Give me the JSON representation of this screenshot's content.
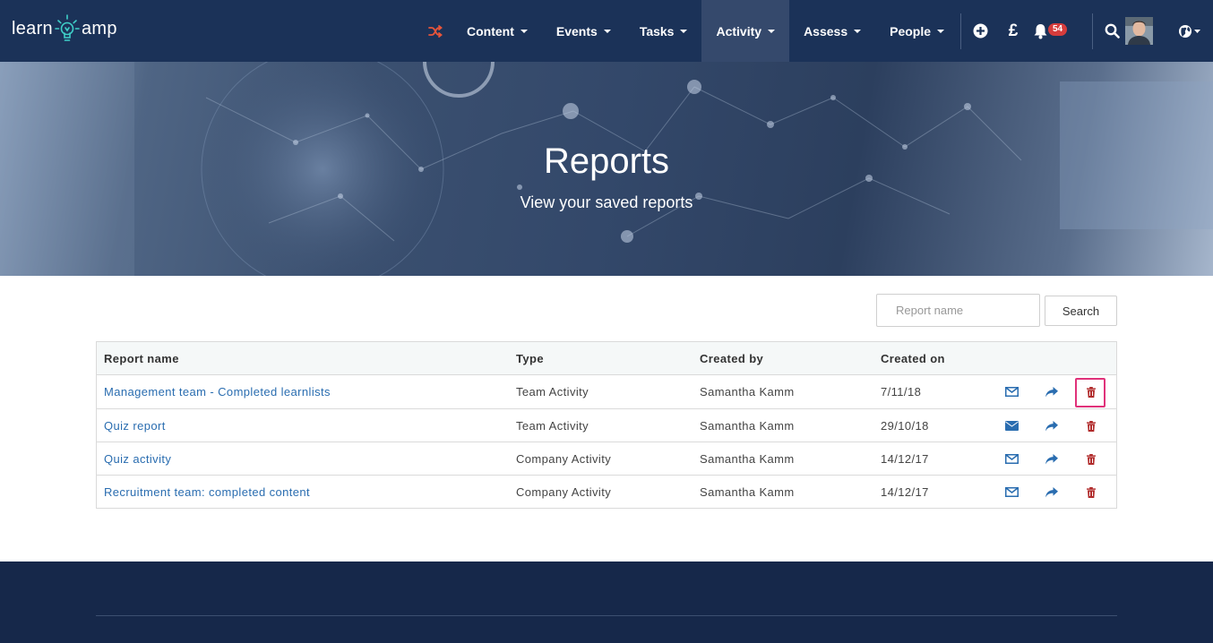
{
  "nav": {
    "logo_left": "learn",
    "logo_right": "amp",
    "items": [
      {
        "label": "Content",
        "active": false
      },
      {
        "label": "Events",
        "active": false
      },
      {
        "label": "Tasks",
        "active": false
      },
      {
        "label": "Activity",
        "active": true
      },
      {
        "label": "Assess",
        "active": false
      },
      {
        "label": "People",
        "active": false
      }
    ],
    "currency_symbol": "£",
    "notification_count": "54",
    "icons": [
      "shuffle-icon",
      "plus-circle-icon",
      "pound-icon",
      "bell-icon",
      "search-icon",
      "avatar",
      "globe-icon"
    ]
  },
  "hero": {
    "title": "Reports",
    "subtitle": "View your saved reports"
  },
  "search": {
    "placeholder": "Report name",
    "button_label": "Search"
  },
  "table": {
    "headers": {
      "name": "Report name",
      "type": "Type",
      "created_by": "Created by",
      "created_on": "Created on"
    },
    "rows": [
      {
        "name": "Management team - Completed learnlists",
        "type": "Team Activity",
        "created_by": "Samantha Kamm",
        "created_on": "7/11/18",
        "mail_filled": false
      },
      {
        "name": "Quiz report",
        "type": "Team Activity",
        "created_by": "Samantha Kamm",
        "created_on": "29/10/18",
        "mail_filled": true
      },
      {
        "name": "Quiz activity",
        "type": "Company Activity",
        "created_by": "Samantha Kamm",
        "created_on": "14/12/17",
        "mail_filled": false
      },
      {
        "name": "Recruitment team: completed content",
        "type": "Company Activity",
        "created_by": "Samantha Kamm",
        "created_on": "14/12/17",
        "mail_filled": false
      }
    ]
  },
  "colors": {
    "navbar": "#1b3258",
    "nav_active": "#35496c",
    "link": "#2a6db0",
    "delete": "#b02a2a",
    "highlight": "#e0327a",
    "badge": "#d63c3c",
    "footer": "#16284a",
    "shuffle": "#e8553a"
  }
}
